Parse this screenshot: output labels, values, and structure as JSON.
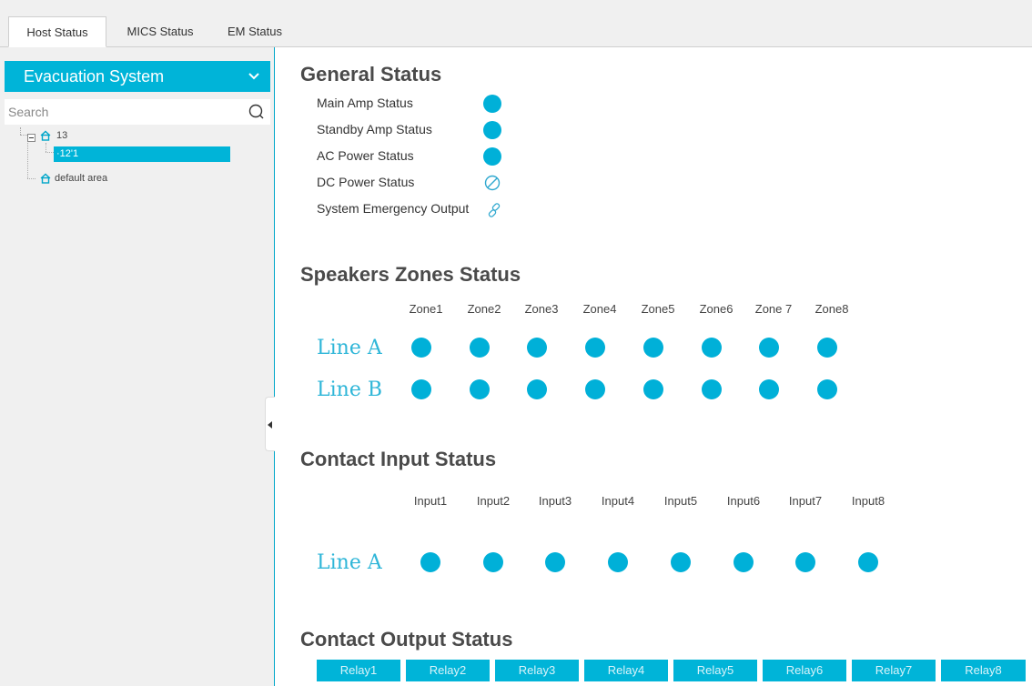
{
  "tabs": [
    {
      "label": "Host Status",
      "active": true
    },
    {
      "label": "MICS Status",
      "active": false
    },
    {
      "label": "EM Status",
      "active": false
    }
  ],
  "sidebar": {
    "title": "Evacuation System",
    "search_placeholder": "Search",
    "tree": [
      {
        "label": "13",
        "icon": "home-icon"
      },
      {
        "label": "·12'1",
        "selected": true
      },
      {
        "label": "default area",
        "icon": "home-icon"
      }
    ]
  },
  "general": {
    "title": "General Status",
    "items": [
      {
        "label": "Main Amp Status",
        "state": "normal"
      },
      {
        "label": "Standby Amp Status",
        "state": "normal"
      },
      {
        "label": "AC Power Status",
        "state": "normal"
      },
      {
        "label": "DC Power Status",
        "state": "disabled"
      },
      {
        "label": "System Emergency Output",
        "state": "linked"
      }
    ]
  },
  "zones": {
    "title": "Speakers Zones Status",
    "columns": [
      "Zone1",
      "Zone2",
      "Zone3",
      "Zone4",
      "Zone5",
      "Zone6",
      "Zone 7",
      "Zone8"
    ],
    "rows": [
      "Line A",
      "Line B"
    ]
  },
  "inputs": {
    "title": "Contact Input Status",
    "columns": [
      "Input1",
      "Input2",
      "Input3",
      "Input4",
      "Input5",
      "Input6",
      "Input7",
      "Input8"
    ],
    "rows": [
      "Line A"
    ]
  },
  "outputs": {
    "title": "Contact Output Status",
    "relays": [
      "Relay1",
      "Relay2",
      "Relay3",
      "Relay4",
      "Relay5",
      "Relay6",
      "Relay7",
      "Relay8"
    ]
  },
  "colors": {
    "accent": "#00b4d8",
    "status_on": "#00b0d8"
  }
}
